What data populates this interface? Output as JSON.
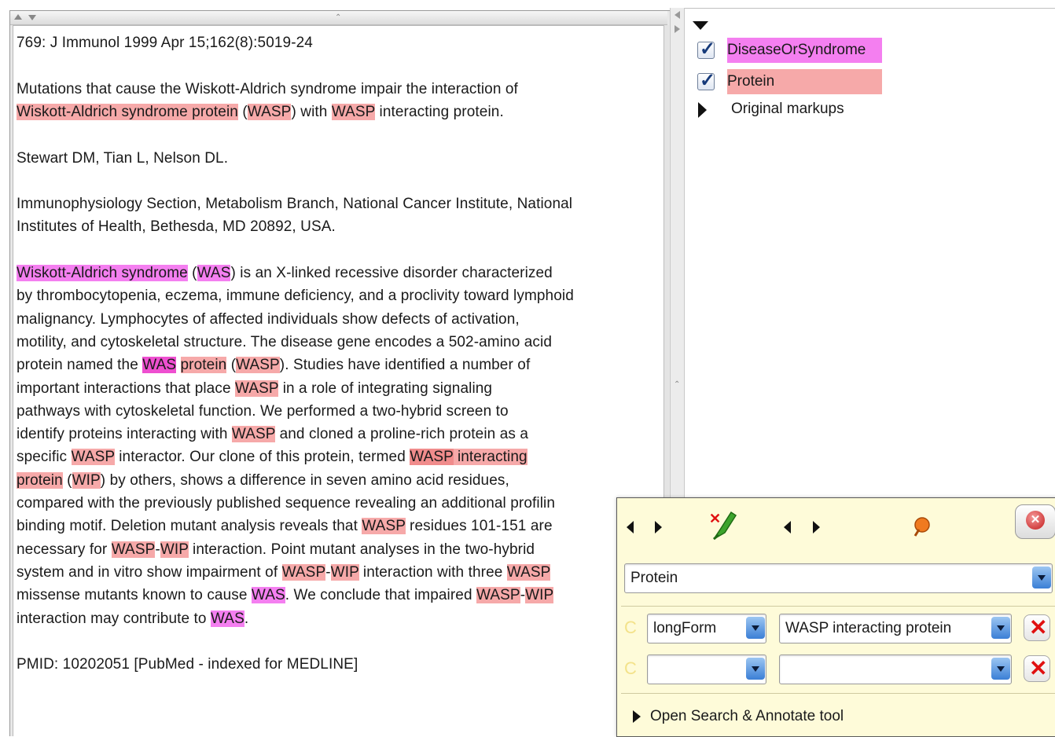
{
  "document": {
    "paragraphs": [
      [
        {
          "t": "769: J Immunol  1999 Apr 15;162(8):5019-24"
        }
      ],
      [],
      [
        {
          "t": "Mutations that cause the Wiskott-Aldrich syndrome impair the interaction of"
        }
      ],
      [
        {
          "t": "Wiskott-Aldrich syndrome protein",
          "h": "p"
        },
        {
          "t": " ("
        },
        {
          "t": "WASP",
          "h": "p"
        },
        {
          "t": ") with "
        },
        {
          "t": "WASP",
          "h": "p"
        },
        {
          "t": " interacting protein."
        }
      ],
      [],
      [
        {
          "t": "Stewart DM, Tian L, Nelson DL."
        }
      ],
      [],
      [
        {
          "t": "Immunophysiology Section, Metabolism Branch, National Cancer Institute, National"
        }
      ],
      [
        {
          "t": "Institutes of Health, Bethesda, MD 20892, USA."
        }
      ],
      [],
      [
        {
          "t": "Wiskott-Aldrich syndrome",
          "h": "d"
        },
        {
          "t": " ("
        },
        {
          "t": "WAS",
          "h": "d"
        },
        {
          "t": ") is an X-linked recessive disorder characterized"
        }
      ],
      [
        {
          "t": "by thrombocytopenia, eczema, immune deficiency, and a proclivity toward lymphoid"
        }
      ],
      [
        {
          "t": "malignancy. Lymphocytes of affected individuals show defects of activation,"
        }
      ],
      [
        {
          "t": "motility, and cytoskeletal structure. The disease gene encodes a 502-amino acid"
        }
      ],
      [
        {
          "t": "protein named the "
        },
        {
          "t": "WAS",
          "h": "d2"
        },
        {
          "t": " "
        },
        {
          "t": "protein",
          "h": "p"
        },
        {
          "t": " ("
        },
        {
          "t": "WASP",
          "h": "p"
        },
        {
          "t": "). Studies have identified a number of"
        }
      ],
      [
        {
          "t": "important interactions that place "
        },
        {
          "t": "WASP",
          "h": "p"
        },
        {
          "t": " in a role of integrating signaling"
        }
      ],
      [
        {
          "t": "pathways with cytoskeletal function. We performed a two-hybrid screen to"
        }
      ],
      [
        {
          "t": "identify proteins interacting with "
        },
        {
          "t": "WASP",
          "h": "p"
        },
        {
          "t": " and cloned a proline-rich protein as a"
        }
      ],
      [
        {
          "t": "specific "
        },
        {
          "t": "WASP",
          "h": "p"
        },
        {
          "t": " interactor. Our clone of this protein, termed "
        },
        {
          "t": "WASP",
          "h": "p2"
        },
        {
          "t": " interacting",
          "h": "p"
        }
      ],
      [
        {
          "t": "protein",
          "h": "p"
        },
        {
          "t": " ("
        },
        {
          "t": "WIP",
          "h": "p"
        },
        {
          "t": ") by others, shows a difference in seven amino acid residues,"
        }
      ],
      [
        {
          "t": "compared with the previously published sequence revealing an additional profilin"
        }
      ],
      [
        {
          "t": "binding motif. Deletion mutant analysis reveals that "
        },
        {
          "t": "WASP",
          "h": "p"
        },
        {
          "t": " residues 101-151 are"
        }
      ],
      [
        {
          "t": "necessary for "
        },
        {
          "t": "WASP",
          "h": "p"
        },
        {
          "t": "-"
        },
        {
          "t": "WIP",
          "h": "p"
        },
        {
          "t": " interaction. Point mutant analyses in the two-hybrid"
        }
      ],
      [
        {
          "t": "system and in vitro show impairment of "
        },
        {
          "t": "WASP",
          "h": "p"
        },
        {
          "t": "-"
        },
        {
          "t": "WIP",
          "h": "p"
        },
        {
          "t": " interaction with three "
        },
        {
          "t": "WASP",
          "h": "p"
        }
      ],
      [
        {
          "t": "missense mutants known to cause "
        },
        {
          "t": "WAS",
          "h": "d"
        },
        {
          "t": ". We conclude that impaired "
        },
        {
          "t": "WASP",
          "h": "p"
        },
        {
          "t": "-"
        },
        {
          "t": "WIP",
          "h": "p"
        }
      ],
      [
        {
          "t": "interaction may contribute to "
        },
        {
          "t": "WAS",
          "h": "d"
        },
        {
          "t": "."
        }
      ],
      [],
      [
        {
          "t": "PMID: 10202051 [PubMed - indexed for MEDLINE]"
        }
      ]
    ]
  },
  "annotation_sets": {
    "items": [
      {
        "label": "DiseaseOrSyndrome",
        "checked": true,
        "color": "#f47ff0"
      },
      {
        "label": "Protein",
        "checked": true,
        "color": "#f6a9a9"
      }
    ],
    "collapsed_group": "Original markups"
  },
  "editor": {
    "type_value": "Protein",
    "features": [
      {
        "name": "longForm",
        "value": "WASP interacting protein"
      },
      {
        "name": "",
        "value": ""
      }
    ],
    "feature_marker": "C",
    "delete_glyph": "✕",
    "close_glyph": "✕",
    "footer_label": "Open Search & Annotate tool"
  },
  "colors": {
    "protein_highlight": "#f6a9a9",
    "disease_highlight": "#f47ff0",
    "editor_bg": "#fefbd9",
    "delete_red": "#e01010"
  }
}
